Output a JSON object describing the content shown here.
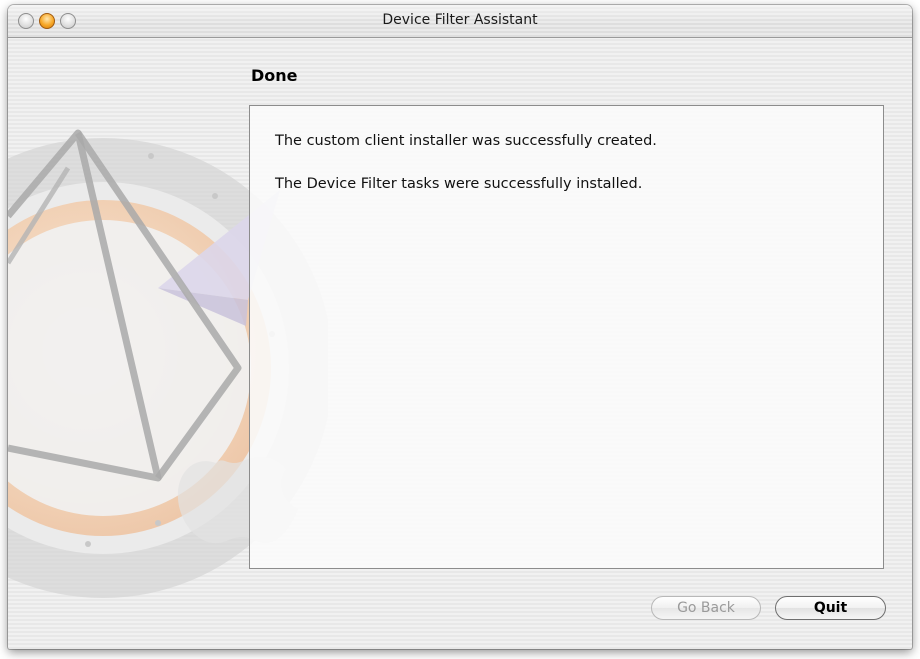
{
  "window": {
    "title": "Device Filter Assistant"
  },
  "step": {
    "title": "Done"
  },
  "messages": [
    "The custom client installer was successfully created.",
    "The Device Filter tasks were successfully installed."
  ],
  "buttons": {
    "back_label": "Go Back",
    "quit_label": "Quit"
  },
  "colors": {
    "minimize_orange": "#f7a828",
    "artwork_peach": "#f4c7a0",
    "artwork_gray": "#c9c9c9"
  }
}
